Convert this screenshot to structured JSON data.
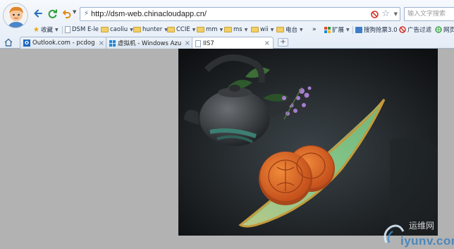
{
  "address": {
    "url": "http://dsm-web.chinacloudapp.cn/"
  },
  "search": {
    "placeholder": "输入文字搜索"
  },
  "favorites": {
    "items": [
      {
        "label": "收藏"
      },
      {
        "label": "DSM E-le"
      },
      {
        "label": "caoliu"
      },
      {
        "label": "hunter"
      },
      {
        "label": "CCIE"
      },
      {
        "label": "mm"
      },
      {
        "label": "ms"
      },
      {
        "label": "wii"
      },
      {
        "label": "电台"
      }
    ],
    "more": "»",
    "extensions": "扩展",
    "screenshot": "搜狗抢票3.0",
    "adblock": "广告过滤",
    "web": "网页"
  },
  "tabs": [
    {
      "label": "Outlook.com - pcdog"
    },
    {
      "label": "虚拟机 - Windows Azu"
    },
    {
      "label": "IIS7"
    }
  ],
  "new_tab": "+",
  "watermark": {
    "text": "iyunv.com",
    "cn": "运维网"
  },
  "colors": {
    "content_bg": "#b2b2b2",
    "accent": "#1d68c4"
  }
}
